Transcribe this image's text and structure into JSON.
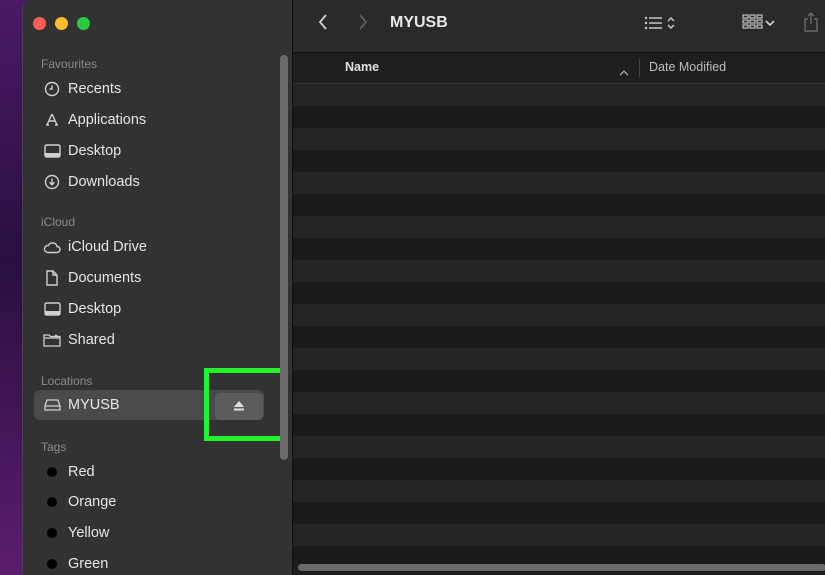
{
  "window": {
    "title": "MYUSB"
  },
  "sidebar": {
    "favourites": {
      "header": "Favourites",
      "items": [
        {
          "label": "Recents",
          "icon": "clock-icon"
        },
        {
          "label": "Applications",
          "icon": "applications-icon"
        },
        {
          "label": "Desktop",
          "icon": "desktop-icon"
        },
        {
          "label": "Downloads",
          "icon": "download-icon"
        }
      ]
    },
    "icloud": {
      "header": "iCloud",
      "items": [
        {
          "label": "iCloud Drive",
          "icon": "cloud-icon"
        },
        {
          "label": "Documents",
          "icon": "document-icon"
        },
        {
          "label": "Desktop",
          "icon": "desktop-icon"
        },
        {
          "label": "Shared",
          "icon": "shared-folder-icon"
        }
      ]
    },
    "locations": {
      "header": "Locations",
      "items": [
        {
          "label": "MYUSB",
          "icon": "drive-icon",
          "selected": true
        }
      ]
    },
    "tags": {
      "header": "Tags",
      "items": [
        {
          "label": "Red",
          "color": "#000000"
        },
        {
          "label": "Orange",
          "color": "#000000"
        },
        {
          "label": "Yellow",
          "color": "#000000"
        },
        {
          "label": "Green",
          "color": "#000000"
        }
      ]
    }
  },
  "columns": {
    "name": "Name",
    "date_modified": "Date Modified"
  },
  "colors": {
    "highlight": "#25f22e",
    "sidebar_bg": "#323232",
    "selected_bg": "#4a4a4a"
  }
}
